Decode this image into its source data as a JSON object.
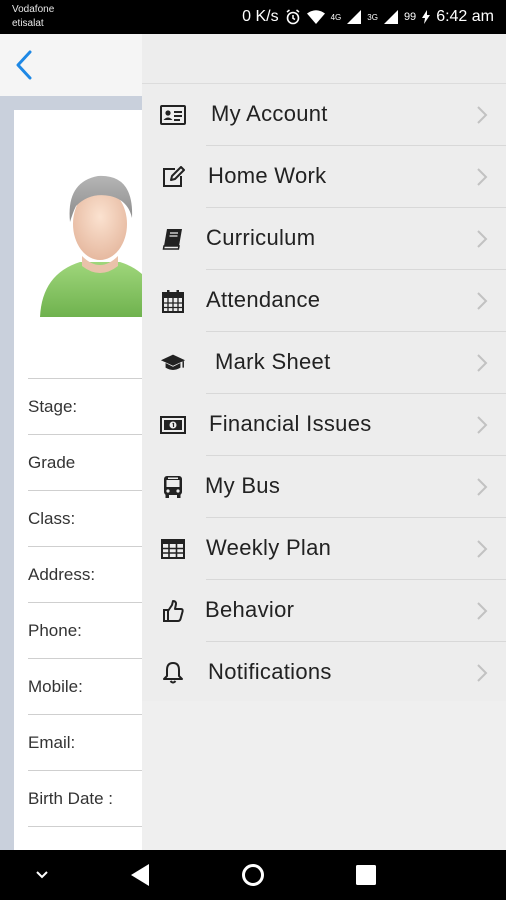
{
  "status_bar": {
    "carrier_1": "Vodafone",
    "carrier_2": "etisalat",
    "net_speed": "0 K/s",
    "signal_tag_1": "4G",
    "signal_tag_2": "3G",
    "battery": "99",
    "time": "6:42 am"
  },
  "profile": {
    "fields": [
      "Stage:",
      "Grade",
      "Class:",
      "Address:",
      "Phone:",
      "Mobile:",
      "Email:",
      "Birth Date :"
    ]
  },
  "menu": {
    "items": [
      {
        "label": "My Account",
        "icon": "id-card-icon"
      },
      {
        "label": "Home Work",
        "icon": "edit-icon"
      },
      {
        "label": "Curriculum",
        "icon": "book-icon"
      },
      {
        "label": "Attendance",
        "icon": "calendar-icon"
      },
      {
        "label": "Mark Sheet",
        "icon": "graduation-cap-icon"
      },
      {
        "label": "Financial Issues",
        "icon": "money-icon"
      },
      {
        "label": "My Bus",
        "icon": "bus-icon"
      },
      {
        "label": "Weekly Plan",
        "icon": "table-icon"
      },
      {
        "label": "Behavior",
        "icon": "thumbs-up-icon"
      },
      {
        "label": "Notifications",
        "icon": "bell-icon"
      }
    ]
  },
  "colors": {
    "accent": "#1e88e5",
    "drawer_bg": "#ededed",
    "backdrop": "#c9d0dc"
  }
}
